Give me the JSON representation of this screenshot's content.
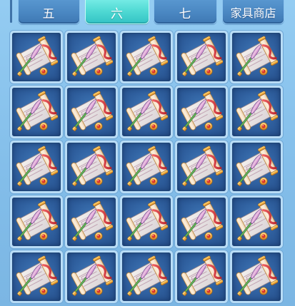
{
  "tabs": [
    {
      "label": "五",
      "active": false
    },
    {
      "label": "六",
      "active": true
    },
    {
      "label": "七",
      "active": false
    },
    {
      "label": "家具商店",
      "active": false
    }
  ],
  "grid": {
    "rows": 5,
    "columns": 5,
    "item_icon": "blueprint-scroll-icon"
  },
  "colors": {
    "tab_active": "#4fd9d3",
    "tab_normal": "#4a87c2",
    "slot_background": "#2f5f9e",
    "panel_background": "#86c2ec"
  }
}
